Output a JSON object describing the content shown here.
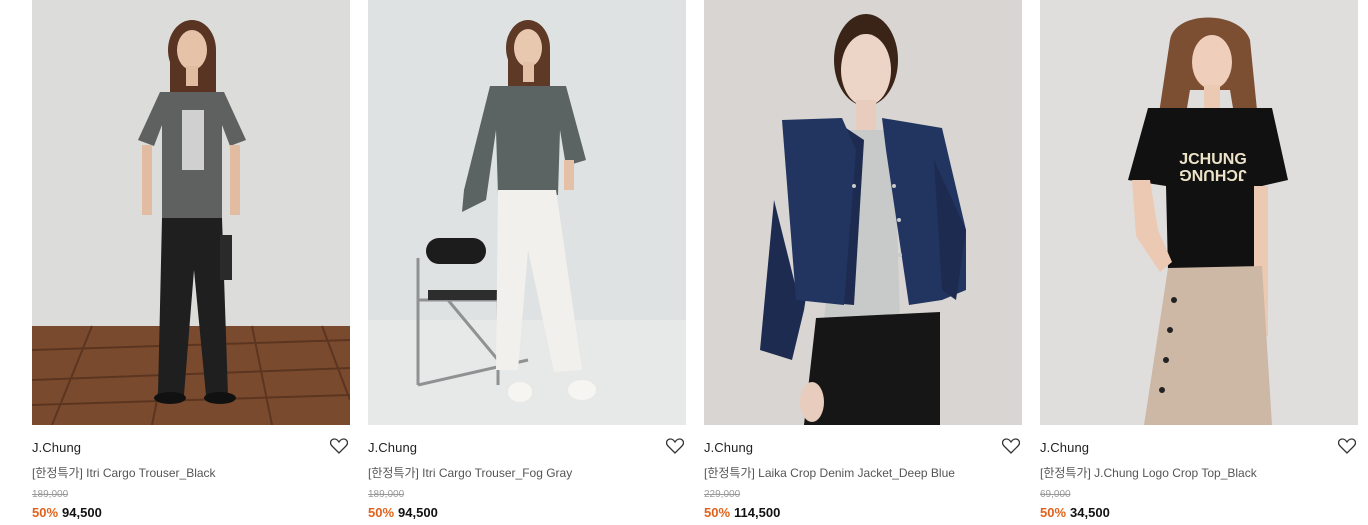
{
  "accent_color": "#e2621b",
  "products": [
    {
      "brand": "J.Chung",
      "name": "[한정특가] Itri Cargo Trouser_Black",
      "original_price": "189,000",
      "discount": "50%",
      "sale_price": "94,500",
      "wishlist_icon": "heart-outline-icon"
    },
    {
      "brand": "J.Chung",
      "name": "[한정특가] Itri Cargo Trouser_Fog Gray",
      "original_price": "189,000",
      "discount": "50%",
      "sale_price": "94,500",
      "wishlist_icon": "heart-outline-icon"
    },
    {
      "brand": "J.Chung",
      "name": "[한정특가] Laika Crop Denim Jacket_Deep Blue",
      "original_price": "229,000",
      "discount": "50%",
      "sale_price": "114,500",
      "wishlist_icon": "heart-outline-icon"
    },
    {
      "brand": "J.Chung",
      "name": "[한정특가] J.Chung Logo Crop Top_Black",
      "original_price": "69,000",
      "discount": "50%",
      "sale_price": "34,500",
      "wishlist_icon": "heart-outline-icon"
    }
  ],
  "photo_text": {
    "tee_logo_line1": "JCHUNG",
    "tee_logo_line2": "JCHUNG"
  }
}
